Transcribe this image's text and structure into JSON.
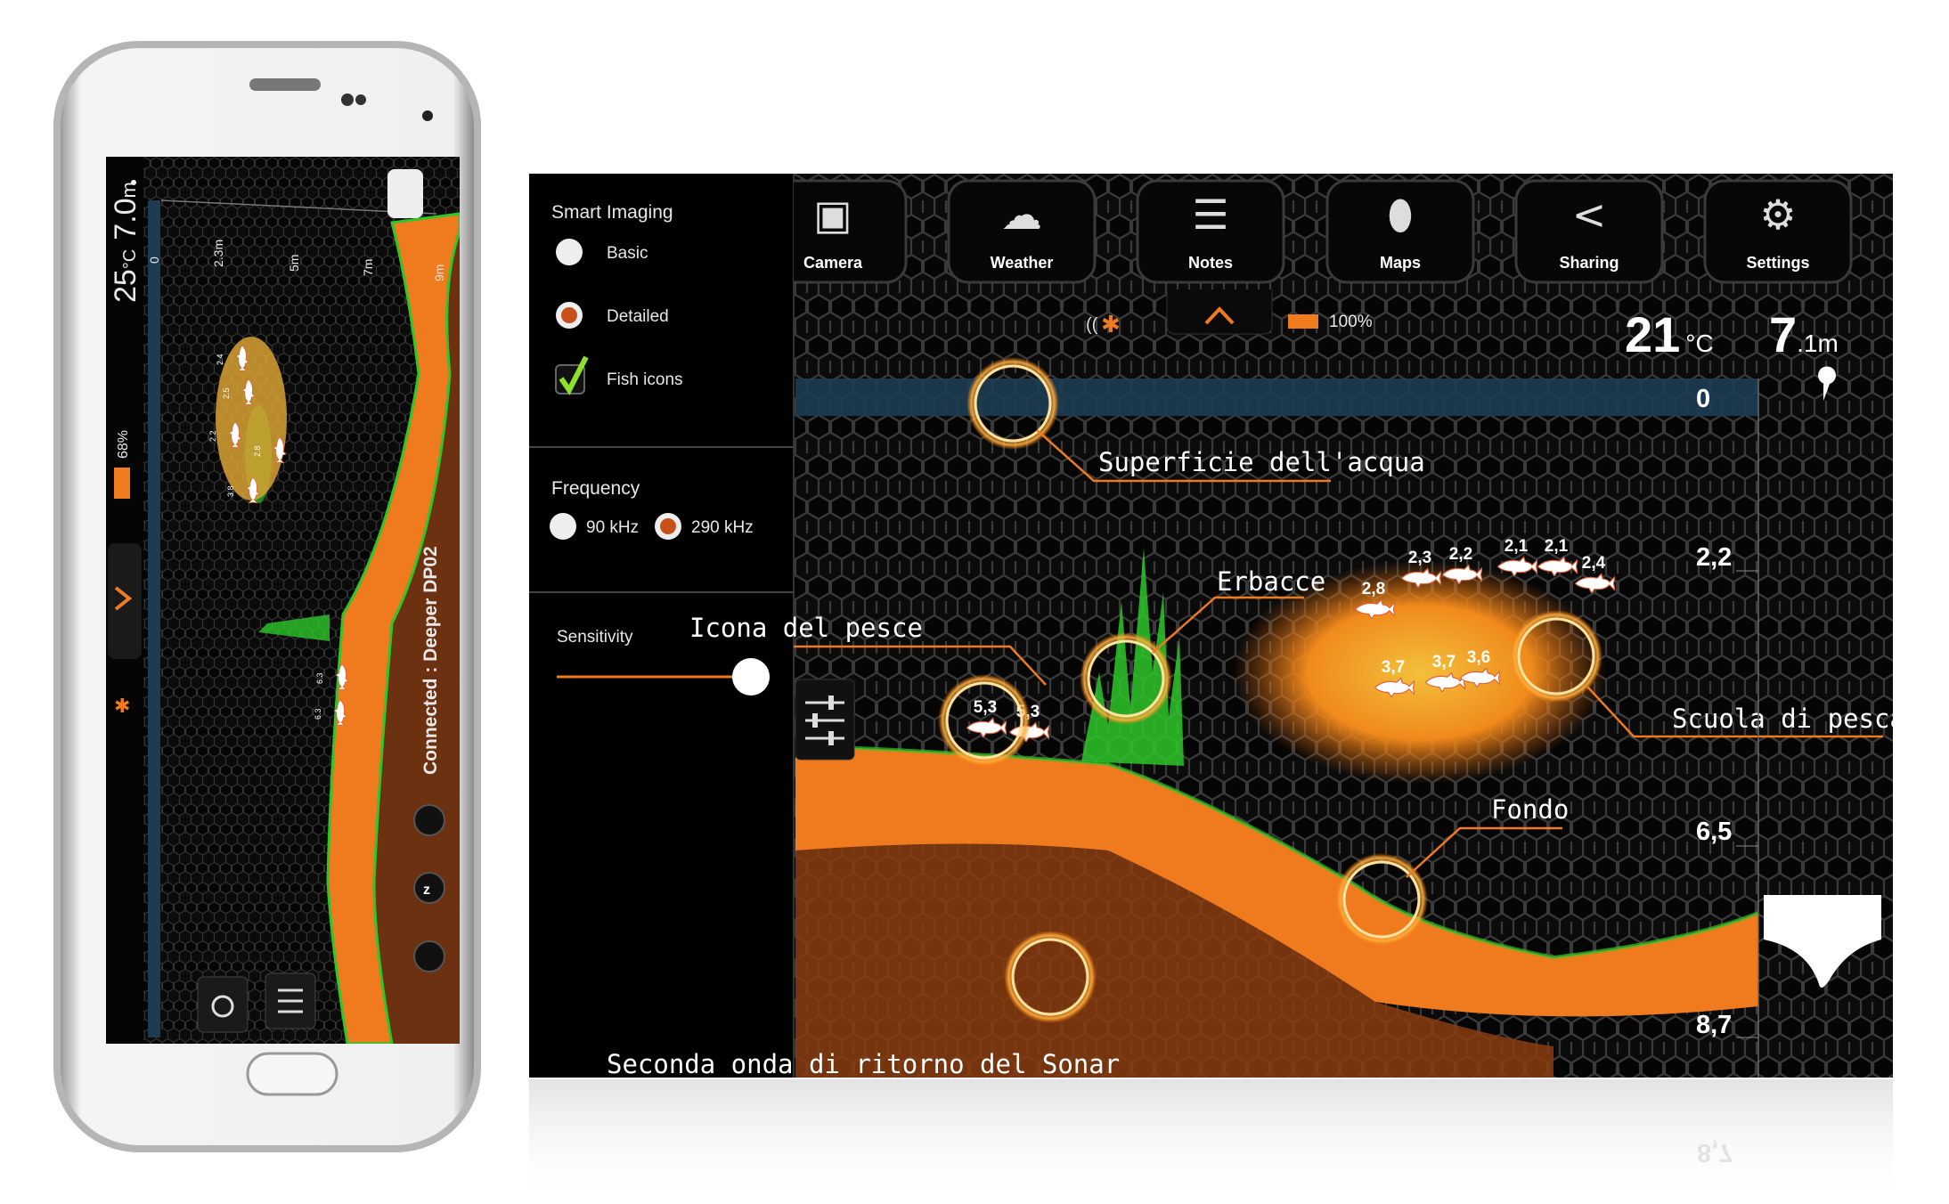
{
  "phone": {
    "temperature": "25",
    "temperature_unit": "°C",
    "depth": "7.0",
    "depth_unit": "m",
    "battery": "68%",
    "scale_labels": [
      "0",
      "2.3m",
      "5m",
      "7m",
      "9m"
    ],
    "status": "Connected : Deeper DP02",
    "fish_labels": [
      "2.4",
      "2.5",
      "2.2",
      "2.8",
      "3.8",
      "6.3",
      "6.3"
    ],
    "icons": [
      "bluetooth-icon",
      "chevron-right-icon",
      "battery-icon",
      "fish-alarm-icon",
      "sleep-icon",
      "sonar-icon",
      "history-icon",
      "sliders-icon",
      "boat-icon"
    ]
  },
  "tablet": {
    "settings": {
      "smart_imaging_title": "Smart Imaging",
      "basic_label": "Basic",
      "detailed_label": "Detailed",
      "fish_icons_label": "Fish icons",
      "selected_mode": "Detailed",
      "fish_icons_checked": true,
      "frequency_title": "Frequency",
      "freq_low_label": "90 kHz",
      "freq_high_label": "290 kHz",
      "selected_frequency": "290 kHz",
      "sensitivity_title": "Sensitivity",
      "sensitivity_level": 1.0
    },
    "toolbar": [
      {
        "label": "Camera",
        "icon": "camera-icon"
      },
      {
        "label": "Weather",
        "icon": "weather-icon"
      },
      {
        "label": "Notes",
        "icon": "notes-icon"
      },
      {
        "label": "Maps",
        "icon": "map-pin-icon"
      },
      {
        "label": "Sharing",
        "icon": "share-icon"
      },
      {
        "label": "Settings",
        "icon": "gear-icon"
      }
    ],
    "status": {
      "battery": "100%",
      "temperature": "21",
      "temperature_unit": "°C",
      "depth": "7",
      "depth_unit": ".1m"
    },
    "depth_scale": [
      "0",
      "2,2",
      "6,5",
      "8,7"
    ],
    "fish_labels": [
      "5,3",
      "5,3",
      "2,3",
      "2,2",
      "2,1",
      "2,1",
      "2,4",
      "2,8",
      "3,7",
      "3,7",
      "3,6"
    ],
    "annotations": {
      "surface": "Superficie dell'acqua",
      "weeds": "Erbacce",
      "fish_icon": "Icona del pesce",
      "fish_school": "Scuola di pesca",
      "bottom": "Fondo",
      "second_return": "Seconda onda di ritorno del Sonar"
    },
    "reflection_depth": "8,7"
  },
  "colors": {
    "accent": "#f07a1e",
    "water_surface": "#1d3c52",
    "weeds": "#2ec72a",
    "background": "#0a0a0a"
  }
}
